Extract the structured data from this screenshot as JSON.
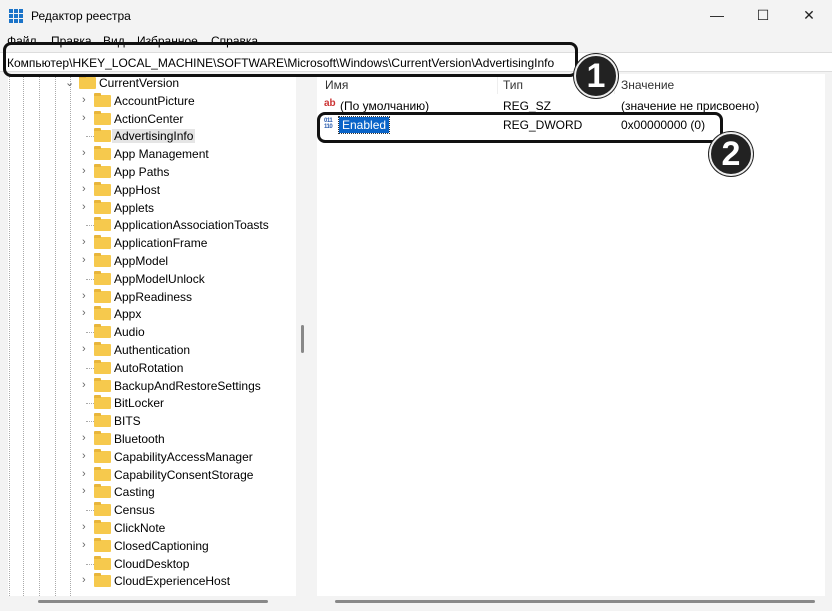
{
  "window": {
    "title": "Редактор реестра",
    "icon": "regedit-icon"
  },
  "menu": [
    "Файл",
    "Правка",
    "Вид",
    "Избранное",
    "Справка"
  ],
  "address": "Компьютер\\HKEY_LOCAL_MACHINE\\SOFTWARE\\Microsoft\\Windows\\CurrentVersion\\AdvertisingInfo",
  "tree": {
    "parent": "CurrentVersion",
    "items": [
      {
        "label": "AccountPicture",
        "expandable": true
      },
      {
        "label": "ActionCenter",
        "expandable": true
      },
      {
        "label": "AdvertisingInfo",
        "expandable": false,
        "selected": true
      },
      {
        "label": "App Management",
        "expandable": true
      },
      {
        "label": "App Paths",
        "expandable": true
      },
      {
        "label": "AppHost",
        "expandable": true
      },
      {
        "label": "Applets",
        "expandable": true
      },
      {
        "label": "ApplicationAssociationToasts",
        "expandable": false
      },
      {
        "label": "ApplicationFrame",
        "expandable": true
      },
      {
        "label": "AppModel",
        "expandable": true
      },
      {
        "label": "AppModelUnlock",
        "expandable": false
      },
      {
        "label": "AppReadiness",
        "expandable": true
      },
      {
        "label": "Appx",
        "expandable": true
      },
      {
        "label": "Audio",
        "expandable": false
      },
      {
        "label": "Authentication",
        "expandable": true
      },
      {
        "label": "AutoRotation",
        "expandable": false
      },
      {
        "label": "BackupAndRestoreSettings",
        "expandable": true
      },
      {
        "label": "BitLocker",
        "expandable": false
      },
      {
        "label": "BITS",
        "expandable": false
      },
      {
        "label": "Bluetooth",
        "expandable": true
      },
      {
        "label": "CapabilityAccessManager",
        "expandable": true
      },
      {
        "label": "CapabilityConsentStorage",
        "expandable": true
      },
      {
        "label": "Casting",
        "expandable": true
      },
      {
        "label": "Census",
        "expandable": false
      },
      {
        "label": "ClickNote",
        "expandable": true
      },
      {
        "label": "ClosedCaptioning",
        "expandable": true
      },
      {
        "label": "CloudDesktop",
        "expandable": false
      },
      {
        "label": "CloudExperienceHost",
        "expandable": true
      }
    ]
  },
  "values": {
    "columns": [
      "Имя",
      "Тип",
      "Значение"
    ],
    "rows": [
      {
        "name": "(По умолчанию)",
        "type": "REG_SZ",
        "data": "(значение не присвоено)",
        "icon": "string-value-icon"
      },
      {
        "name": "Enabled",
        "type": "REG_DWORD",
        "data": "0x00000000 (0)",
        "icon": "binary-value-icon",
        "selected": true
      }
    ]
  },
  "annotations": [
    "1",
    "2"
  ],
  "colors": {
    "selection": "#0a64c8",
    "folder": "#f6c94d"
  }
}
